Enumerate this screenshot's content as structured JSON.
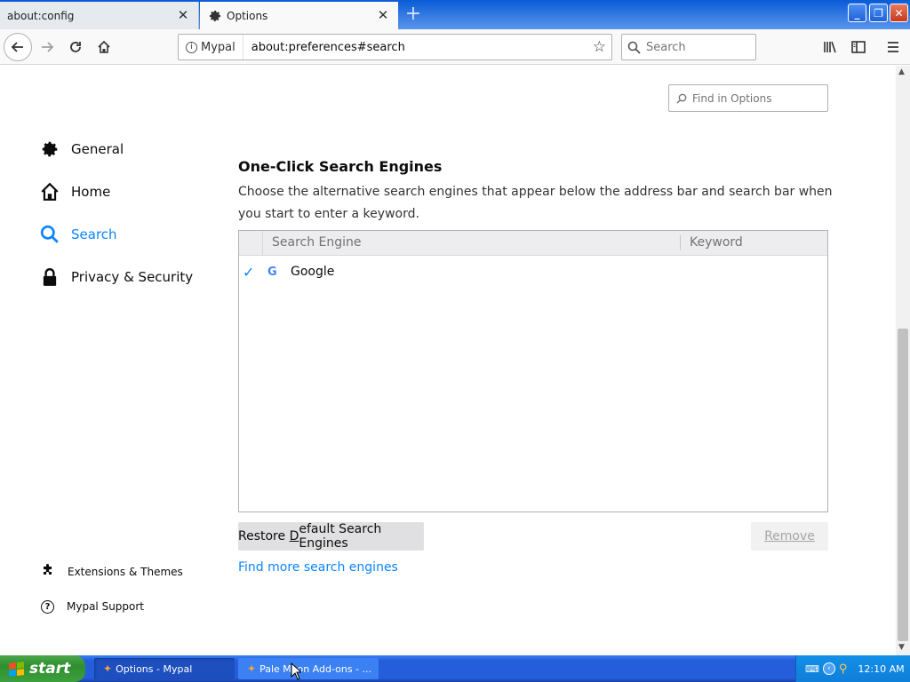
{
  "tabs": [
    {
      "label": "about:config"
    },
    {
      "label": "Options"
    }
  ],
  "navbar": {
    "identity_label": "Mypal",
    "url": "about:preferences#search",
    "search_placeholder": "Search"
  },
  "find_in_options": "Find in Options",
  "sidebar": {
    "categories": [
      {
        "label": "General",
        "icon": "gear-icon"
      },
      {
        "label": "Home",
        "icon": "home-icon"
      },
      {
        "label": "Search",
        "icon": "search-icon"
      },
      {
        "label": "Privacy & Security",
        "icon": "lock-icon"
      }
    ],
    "footer": [
      {
        "label": "Extensions & Themes",
        "icon": "puzzle-icon"
      },
      {
        "label": "Mypal Support",
        "icon": "help-icon"
      }
    ],
    "selected": "Search"
  },
  "main": {
    "title": "One-Click Search Engines",
    "description": "Choose the alternative search engines that appear below the address bar and search bar when you start to enter a keyword.",
    "table": {
      "headers": [
        "Search Engine",
        "Keyword"
      ],
      "rows": [
        {
          "checked": true,
          "name": "Google",
          "keyword": ""
        }
      ]
    },
    "restore_label_pre": "Restore ",
    "restore_label_accel": "D",
    "restore_label_post": "efault Search Engines",
    "remove_label": "Remove",
    "find_more": "Find more search engines"
  },
  "taskbar": {
    "start": "start",
    "tasks": [
      {
        "label": "Options - Mypal"
      },
      {
        "label": "Pale Moon Add-ons - ..."
      }
    ],
    "clock": "12:10 AM"
  },
  "colors": {
    "accent": "#0a84ff",
    "taskbar": "#245edb",
    "start": "#3c9f3c"
  }
}
